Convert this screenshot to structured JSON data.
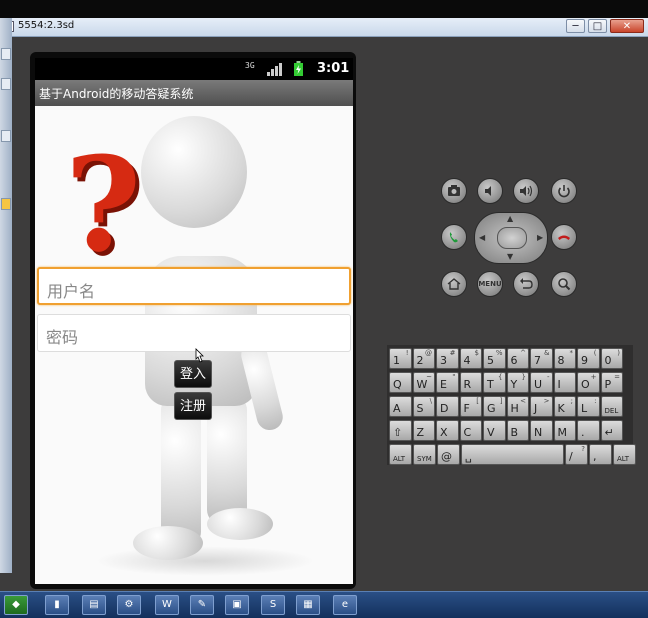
{
  "window": {
    "title": "5554:2.3sd",
    "min_label": "─",
    "max_label": "□",
    "close_label": "✕"
  },
  "status_bar": {
    "network": "3G",
    "time": "3:01"
  },
  "app": {
    "title": "基于Android的移动答疑系统",
    "username_placeholder": "用户名",
    "password_placeholder": "密码",
    "login_label": "登入",
    "register_label": "注册"
  },
  "controls": {
    "menu_label": "MENU"
  },
  "keyboard": {
    "rows": [
      [
        [
          "1",
          "!"
        ],
        [
          "2",
          "@"
        ],
        [
          "3",
          "#"
        ],
        [
          "4",
          "$"
        ],
        [
          "5",
          "%"
        ],
        [
          "6",
          "^"
        ],
        [
          "7",
          "&"
        ],
        [
          "8",
          "*"
        ],
        [
          "9",
          "("
        ],
        [
          "0",
          ")"
        ]
      ],
      [
        [
          "Q",
          ""
        ],
        [
          "W",
          "~"
        ],
        [
          "E",
          "\""
        ],
        [
          "R",
          ""
        ],
        [
          "T",
          "{"
        ],
        [
          "Y",
          "}"
        ],
        [
          "U",
          "-"
        ],
        [
          "I",
          ""
        ],
        [
          "O",
          "+"
        ],
        [
          "P",
          "="
        ]
      ],
      [
        [
          "A",
          ""
        ],
        [
          "S",
          "\\"
        ],
        [
          "D",
          ""
        ],
        [
          "F",
          "["
        ],
        [
          "G",
          "]"
        ],
        [
          "H",
          "<"
        ],
        [
          "J",
          ">"
        ],
        [
          "K",
          ";"
        ],
        [
          "L",
          ":"
        ],
        [
          "DEL",
          ""
        ]
      ],
      [
        [
          "⇧",
          ""
        ],
        [
          "Z",
          ""
        ],
        [
          "X",
          ""
        ],
        [
          "C",
          ""
        ],
        [
          "V",
          ""
        ],
        [
          "B",
          ""
        ],
        [
          "N",
          ""
        ],
        [
          "M",
          ""
        ],
        [
          ".",
          ""
        ],
        [
          "↵",
          ""
        ]
      ],
      [
        [
          "ALT",
          ""
        ],
        [
          "SYM",
          ""
        ],
        [
          "@",
          ""
        ],
        [
          "␣",
          ""
        ],
        [
          "/",
          "?"
        ],
        [
          ",",
          ""
        ],
        [
          "ALT",
          ""
        ]
      ]
    ]
  },
  "colors": {
    "input_focus": "#f0a030",
    "question_mark": "#d62a12",
    "emulator_bg": "#3d3c3c"
  }
}
